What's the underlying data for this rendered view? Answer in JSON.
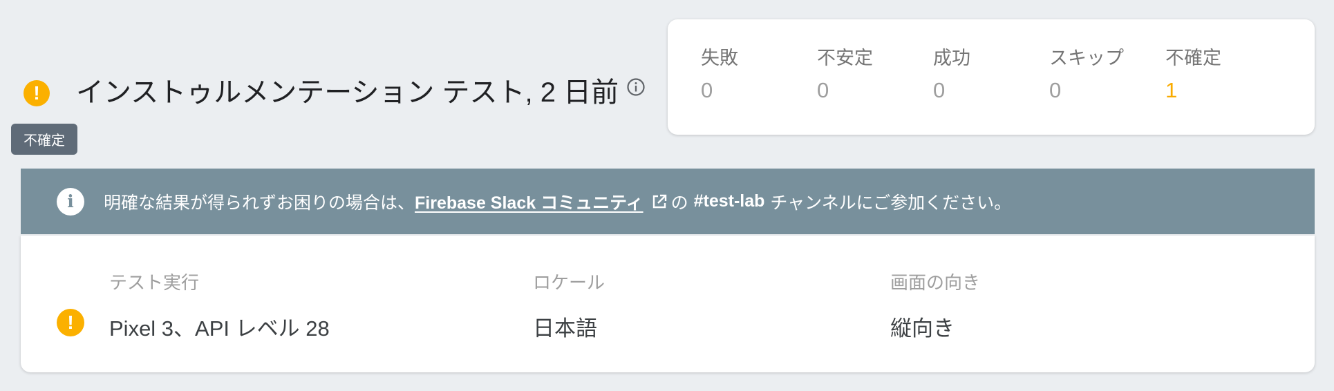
{
  "header": {
    "status_icon": "exclamation-icon",
    "status_color": "#fbb000",
    "title": "インストゥルメンテーション テスト, 2 日前",
    "info_icon": "info-icon",
    "tooltip": "不確定"
  },
  "summary": {
    "stats": [
      {
        "label": "失敗",
        "value": "0"
      },
      {
        "label": "不安定",
        "value": "0"
      },
      {
        "label": "成功",
        "value": "0"
      },
      {
        "label": "スキップ",
        "value": "0"
      },
      {
        "label": "不確定",
        "value": "1",
        "color": "#f9ab00"
      }
    ]
  },
  "banner": {
    "icon": "info-icon",
    "background": "#78909c",
    "text_before": "明確な結果が得られずお困りの場合は、",
    "link_text": "Firebase Slack コミュニティ",
    "link_icon": "external-link-icon",
    "text_mid": "の",
    "channel": "#test-lab",
    "text_after": "チャンネルにご参加ください。"
  },
  "execution": {
    "status_icon": "exclamation-icon",
    "columns": [
      {
        "label": "テスト実行",
        "value": "Pixel 3、API レベル 28"
      },
      {
        "label": "ロケール",
        "value": "日本語"
      },
      {
        "label": "画面の向き",
        "value": "縦向き"
      }
    ]
  }
}
